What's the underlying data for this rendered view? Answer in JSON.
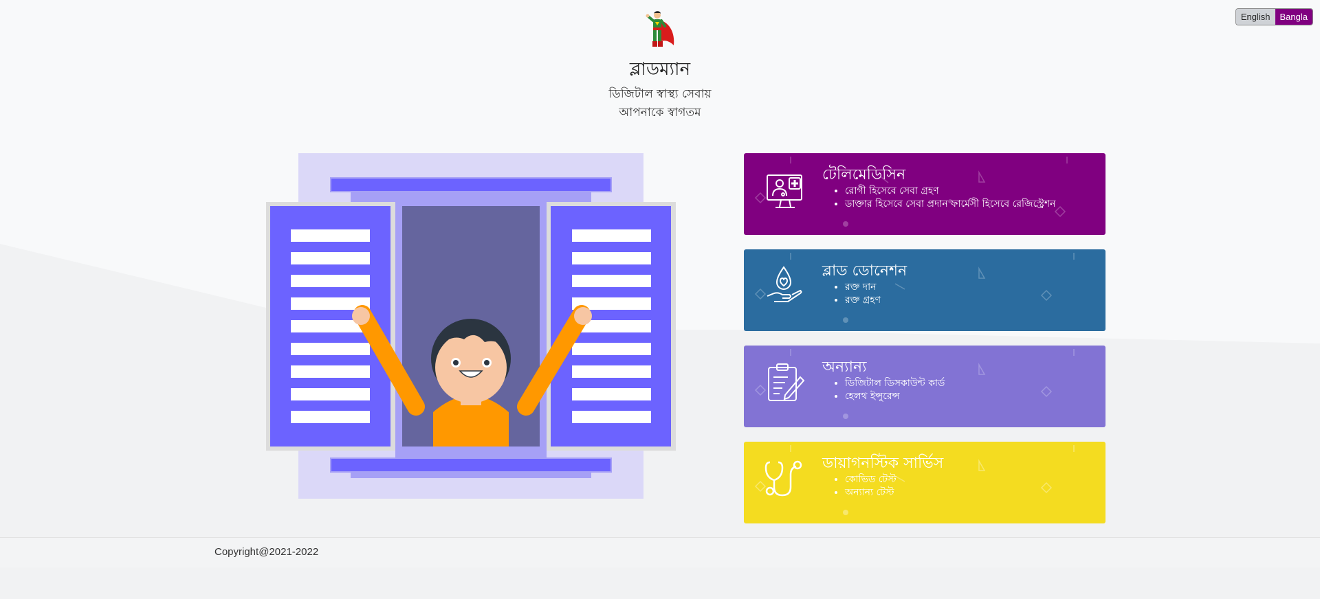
{
  "language_switch": {
    "english": "English",
    "bangla": "Bangla",
    "active": "Bangla"
  },
  "header": {
    "brand": "ব্লাডম্যান",
    "tagline_line1": "ডিজিটাল স্বাস্থ্য সেবায়",
    "tagline_line2": "আপনাকে স্বাগতম"
  },
  "cards": [
    {
      "title": "টেলিমেডিসিন",
      "icon": "telemedicine-icon",
      "color": "#800080",
      "items": [
        "রোগী হিসেবে সেবা গ্রহণ",
        "ডাক্তার হিসেবে সেবা প্রদান ফার্মেসী হিসেবে রেজিস্ট্রেশন"
      ]
    },
    {
      "title": "ব্লাড ডোনেশন",
      "icon": "blood-donation-icon",
      "color": "#2b6c9f",
      "items": [
        "রক্ত দান",
        "রক্ত গ্রহণ"
      ]
    },
    {
      "title": "অন্যান্য",
      "icon": "clipboard-pen-icon",
      "color": "#8273d4",
      "items": [
        "ডিজিটাল ডিসকাউন্ট কার্ড",
        "হেলথ ইন্সুরেন্স"
      ]
    },
    {
      "title": "ডায়াগনস্টিক সার্ভিস",
      "icon": "stethoscope-icon",
      "color": "#f4dc20",
      "items": [
        "কোভিড টেস্ট",
        "অন্যান্য টেস্ট"
      ]
    }
  ],
  "footer": {
    "copyright": "Copyright@2021-2022"
  }
}
